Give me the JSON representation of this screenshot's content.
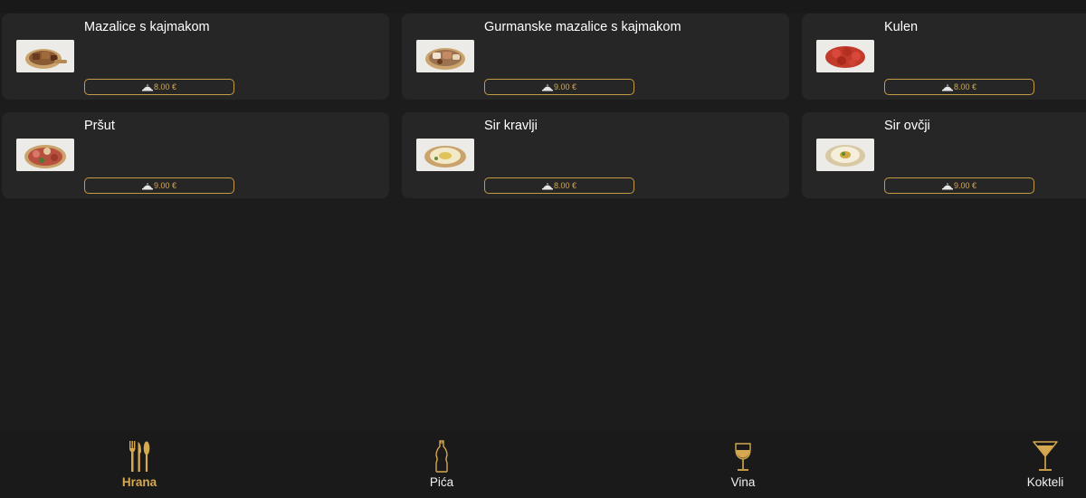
{
  "menu_items": [
    {
      "name": "Mazalice s kajmakom",
      "price": "8.00 €",
      "image": "mazalice-dish-image"
    },
    {
      "name": "Gurmanske mazalice s kajmakom",
      "price": "9.00 €",
      "image": "gurmanske-mazalice-dish-image"
    },
    {
      "name": "Kulen",
      "price": "8.00 €",
      "image": "kulen-dish-image"
    },
    {
      "name": "Pršut",
      "price": "9.00 €",
      "image": "prsut-dish-image"
    },
    {
      "name": "Sir kravlji",
      "price": "8.00 €",
      "image": "sir-kravlji-dish-image"
    },
    {
      "name": "Sir ovčji",
      "price": "9.00 €",
      "image": "sir-ovcji-dish-image"
    }
  ],
  "bottom_nav": [
    {
      "label": "Hrana",
      "icon": "cutlery-icon",
      "active": true
    },
    {
      "label": "Pića",
      "icon": "bottle-icon",
      "active": false
    },
    {
      "label": "Vina",
      "icon": "wine-glass-icon",
      "active": false
    },
    {
      "label": "Kokteli",
      "icon": "cocktail-glass-icon",
      "active": false
    }
  ],
  "colors": {
    "background": "#1c1c1c",
    "card": "#262626",
    "accent": "#d6a84f",
    "text": "#ffffff"
  }
}
